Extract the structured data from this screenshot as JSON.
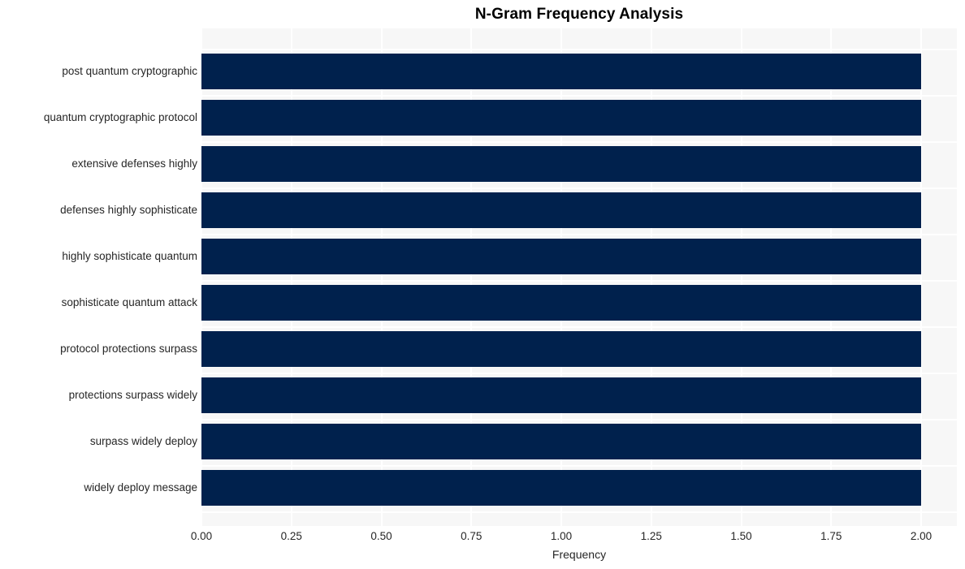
{
  "chart_data": {
    "type": "bar",
    "orientation": "horizontal",
    "title": "N-Gram Frequency Analysis",
    "xlabel": "Frequency",
    "ylabel": "",
    "categories": [
      "post quantum cryptographic",
      "quantum cryptographic protocol",
      "extensive defenses highly",
      "defenses highly sophisticate",
      "highly sophisticate quantum",
      "sophisticate quantum attack",
      "protocol protections surpass",
      "protections surpass widely",
      "surpass widely deploy",
      "widely deploy message"
    ],
    "values": [
      2,
      2,
      2,
      2,
      2,
      2,
      2,
      2,
      2,
      2
    ],
    "xticks": [
      "0.00",
      "0.25",
      "0.50",
      "0.75",
      "1.00",
      "1.25",
      "1.50",
      "1.75",
      "2.00"
    ],
    "xtick_values": [
      0,
      0.25,
      0.5,
      0.75,
      1.0,
      1.25,
      1.5,
      1.75,
      2.0
    ],
    "xlim": [
      0,
      2.0
    ],
    "grid": true,
    "legend": "none",
    "colors": {
      "bar": "#00214d",
      "plot_background": "#f7f7f7",
      "figure_background": "#ffffff",
      "gridline": "#ffffff",
      "text": "#262626",
      "title": "#000000"
    }
  }
}
